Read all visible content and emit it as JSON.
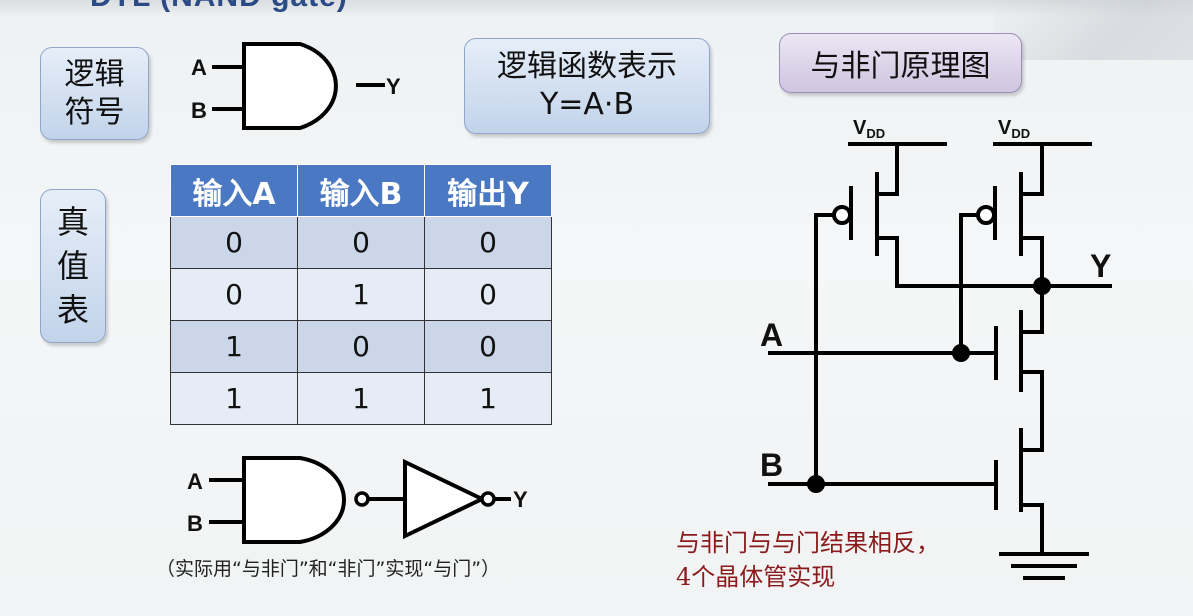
{
  "slide_title": "DTL (NAND gate)",
  "labels": {
    "logic_symbol": [
      "逻辑",
      "符号"
    ],
    "logic_function_title": "逻辑函数表示",
    "logic_function_expr": "Y=A·B",
    "schematic_title": "与非门原理图",
    "truth_table_title": [
      "真",
      "值",
      "表"
    ]
  },
  "gate_symbol": {
    "input_a": "A",
    "input_b": "B",
    "output": "Y"
  },
  "truth_table": {
    "headers": [
      "输入A",
      "输入B",
      "输出Y"
    ],
    "rows": [
      [
        "0",
        "0",
        "0"
      ],
      [
        "0",
        "1",
        "0"
      ],
      [
        "1",
        "0",
        "0"
      ],
      [
        "1",
        "1",
        "1"
      ]
    ]
  },
  "nand_not_diagram": {
    "input_a": "A",
    "input_b": "B",
    "output": "Y"
  },
  "caption": "（实际用“与非门”和“非门”实现“与门”）",
  "schematic": {
    "vdd_left": "V",
    "vdd_left_sub": "DD",
    "vdd_right": "V",
    "vdd_right_sub": "DD",
    "input_a": "A",
    "input_b": "B",
    "output": "Y"
  },
  "note": [
    "与非门与与门结果相反，",
    "4个晶体管实现"
  ],
  "colors": {
    "table_header": "#4a78c2",
    "note_text": "#8b1a1a"
  }
}
